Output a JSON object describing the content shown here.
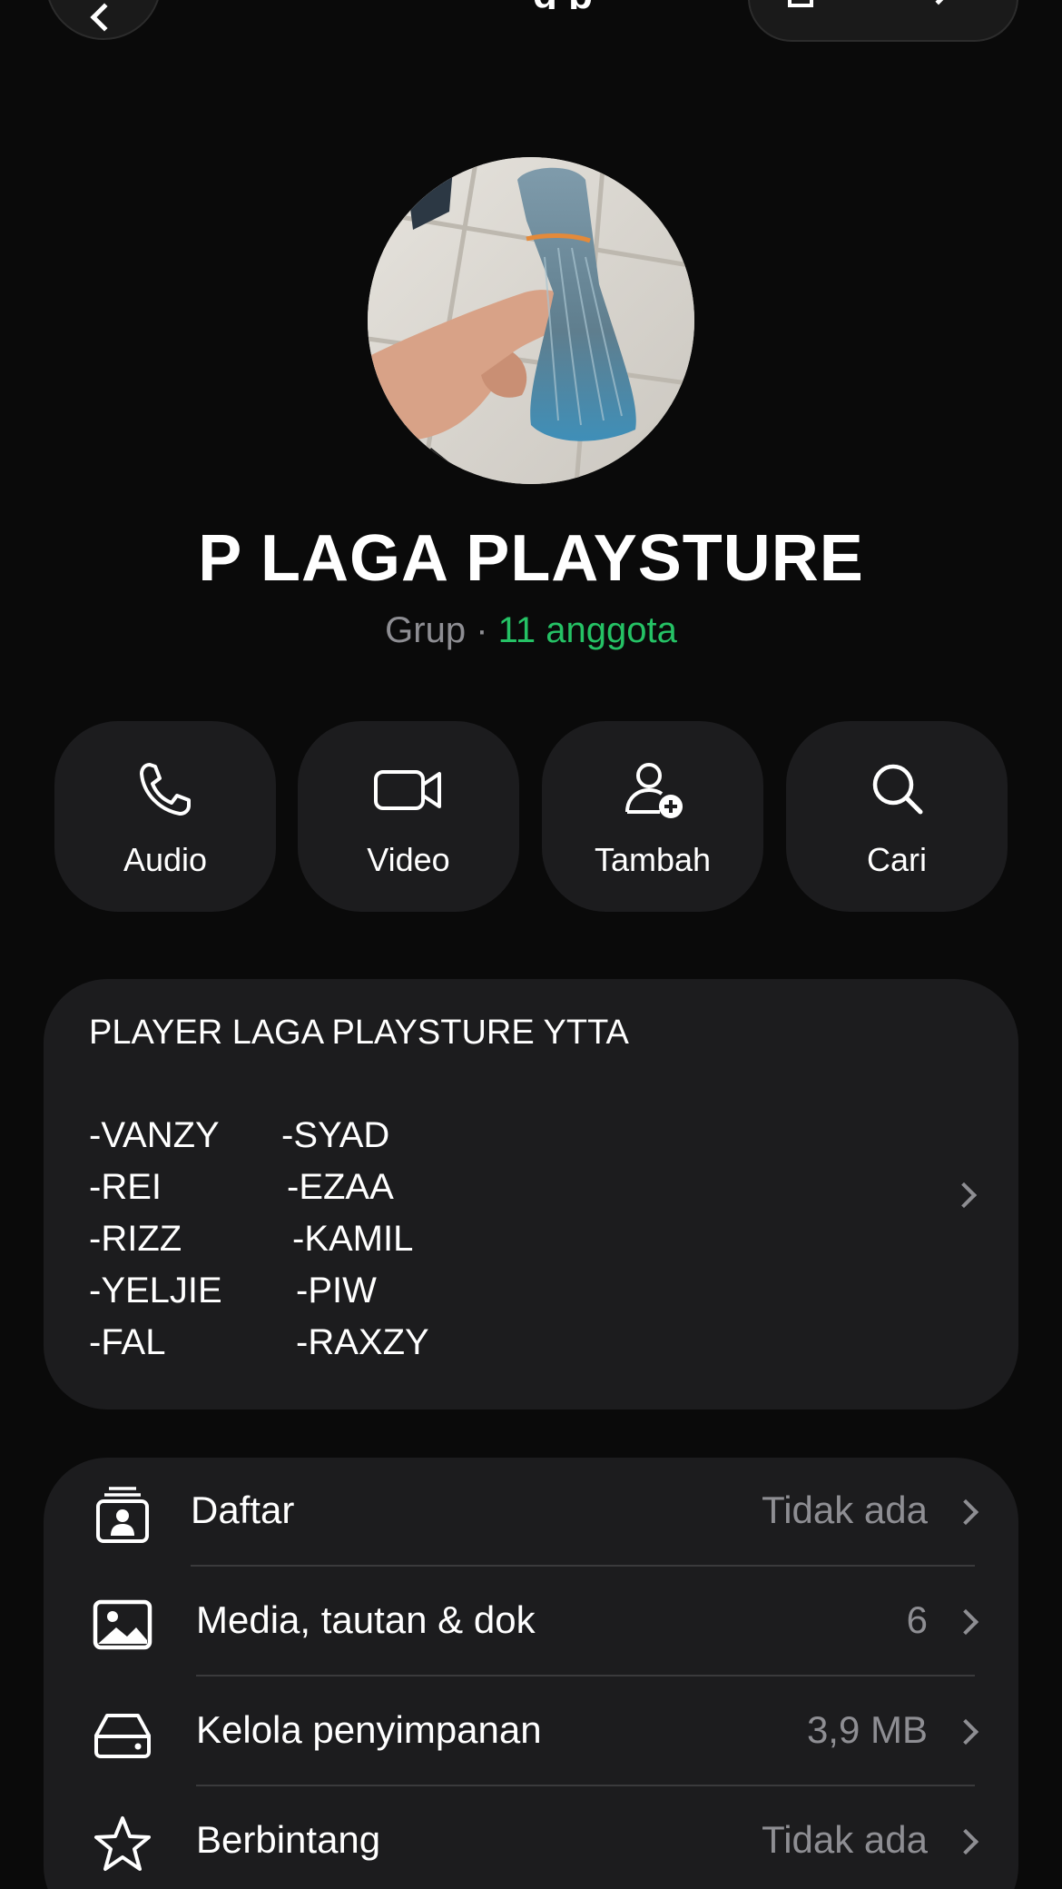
{
  "topbar": {
    "title_partial": "g p"
  },
  "group": {
    "name": "P LAGA PLAYSTURE",
    "type_label": "Grup",
    "separator": " · ",
    "members_label": "11 anggota"
  },
  "actions": [
    {
      "label": "Audio",
      "icon": "phone-icon"
    },
    {
      "label": "Video",
      "icon": "video-camera-icon"
    },
    {
      "label": "Tambah",
      "icon": "add-person-icon"
    },
    {
      "label": "Cari",
      "icon": "search-icon"
    }
  ],
  "description": {
    "title": "PLAYER LAGA PLAYSTURE YTTA",
    "rows": [
      {
        "left": "-VANZY",
        "right": "-SYAD"
      },
      {
        "left": "-REI",
        "right": "-EZAA"
      },
      {
        "left": "-RIZZ",
        "right": "-KAMIL"
      },
      {
        "left": "-YELJIE",
        "right": "-PIW"
      },
      {
        "left": "-FAL",
        "right": "-RAXZY"
      }
    ]
  },
  "settings": [
    {
      "label": "Daftar",
      "value": "Tidak ada",
      "icon": "contact-list-icon"
    },
    {
      "label": "Media, tautan & dok",
      "value": "6",
      "icon": "image-icon"
    },
    {
      "label": "Kelola penyimpanan",
      "value": "3,9 MB",
      "icon": "storage-icon"
    },
    {
      "label": "Berbintang",
      "value": "Tidak ada",
      "icon": "star-icon"
    }
  ],
  "colors": {
    "background": "#0a0a0a",
    "card": "#1c1c1e",
    "accent_green": "#25c265",
    "secondary_text": "#8e8e93"
  }
}
